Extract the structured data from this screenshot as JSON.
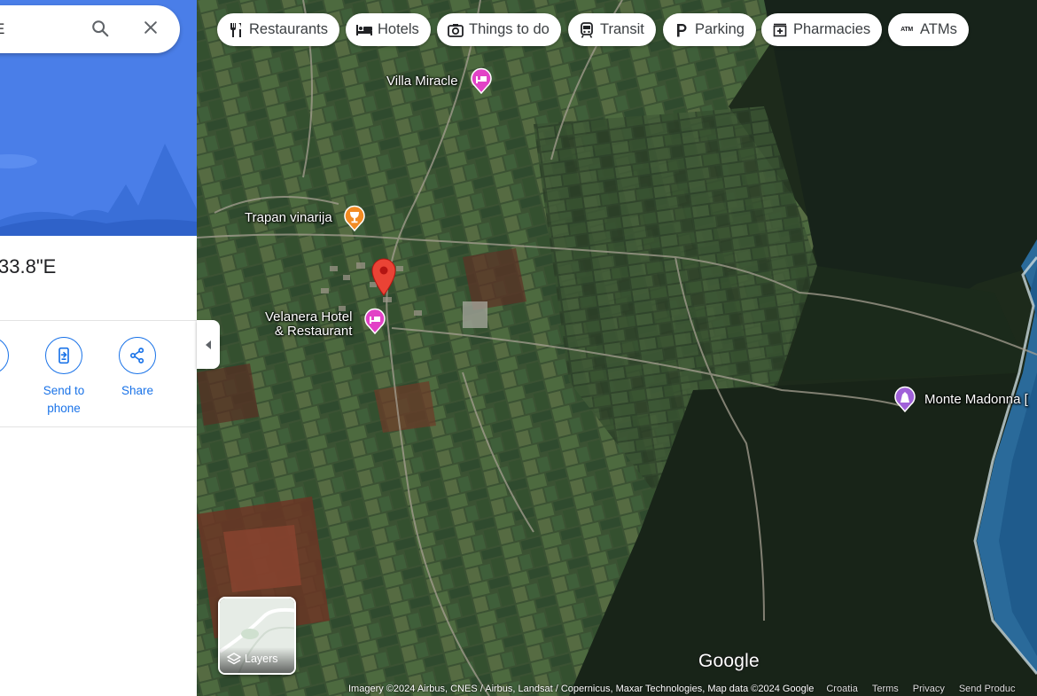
{
  "search": {
    "text": "E",
    "search_label": "Search",
    "close_label": "Close"
  },
  "place": {
    "coordinates_partial": "33.8\"E"
  },
  "actions": [
    {
      "label": "py",
      "icon": "copy-icon"
    },
    {
      "label": "Send to phone",
      "icon": "send-to-phone-icon"
    },
    {
      "label": "Share",
      "icon": "share-icon"
    }
  ],
  "chips": [
    {
      "label": "Restaurants",
      "icon": "fork-knife-icon"
    },
    {
      "label": "Hotels",
      "icon": "bed-icon"
    },
    {
      "label": "Things to do",
      "icon": "camera-icon"
    },
    {
      "label": "Transit",
      "icon": "train-icon"
    },
    {
      "label": "Parking",
      "icon": "parking-icon"
    },
    {
      "label": "Pharmacies",
      "icon": "pharmacy-icon"
    },
    {
      "label": "ATMs",
      "icon": "atm-icon"
    }
  ],
  "map_places": {
    "villa": "Villa Miracle",
    "trapan": "Trapan vinarija",
    "velanera_line1": "Velanera Hotel",
    "velanera_line2": "& Restaurant",
    "monte": "Monte Madonna [",
    "atm_glyph": "ATM"
  },
  "layers": {
    "label": "Layers"
  },
  "logo": {
    "text": "Google"
  },
  "footer": {
    "attribution": "Imagery ©2024 Airbus, CNES / Airbus, Landsat / Copernicus, Maxar Technologies, Map data ©2024 Google",
    "links": [
      "Croatia",
      "Terms",
      "Privacy",
      "Send Produc"
    ]
  },
  "colors": {
    "accent": "#1a73e8",
    "hotel_pin": "#e242c6",
    "winery_pin": "#f28b23",
    "attraction_pin": "#a061d9",
    "selected_pin": "#ea4335",
    "hero_blue": "#4a7ee8"
  }
}
